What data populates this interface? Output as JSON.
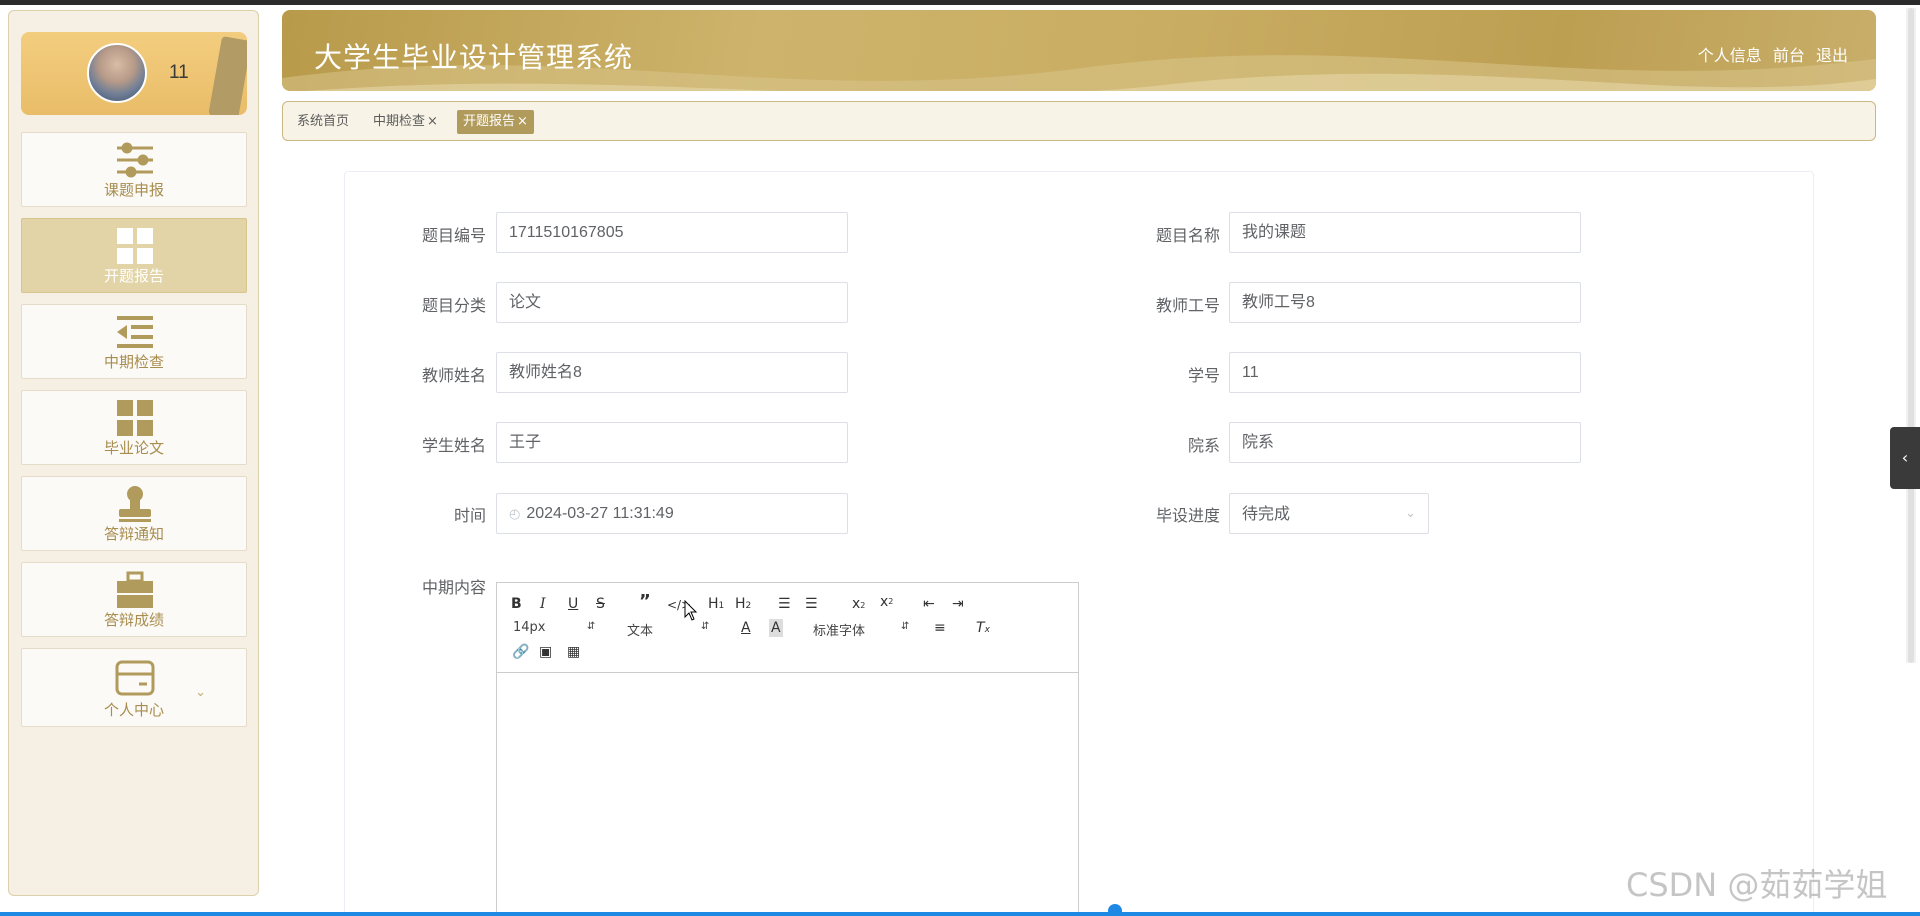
{
  "user": {
    "name": "11"
  },
  "sidebar": {
    "items": [
      {
        "label": "课题申报",
        "icon": "sliders-icon",
        "active": false
      },
      {
        "label": "开题报告",
        "icon": "grid-icon",
        "active": true
      },
      {
        "label": "中期检查",
        "icon": "indent-list-icon",
        "active": false
      },
      {
        "label": "毕业论文",
        "icon": "grid-icon",
        "active": false
      },
      {
        "label": "答辩通知",
        "icon": "stamp-icon",
        "active": false
      },
      {
        "label": "答辩成绩",
        "icon": "briefcase-icon",
        "active": false
      },
      {
        "label": "个人中心",
        "icon": "wallet-icon",
        "active": false,
        "expandable": true
      }
    ]
  },
  "header": {
    "title": "大学生毕业设计管理系统",
    "links": [
      "个人信息",
      "前台",
      "退出"
    ]
  },
  "tabs": [
    {
      "label": "系统首页",
      "closable": false,
      "active": false
    },
    {
      "label": "中期检查",
      "closable": true,
      "active": false
    },
    {
      "label": "开题报告",
      "closable": true,
      "active": true
    }
  ],
  "close_glyph": "×",
  "form": {
    "topic_no": {
      "label": "题目编号",
      "value": "1711510167805"
    },
    "topic_name": {
      "label": "题目名称",
      "value": "我的课题"
    },
    "topic_type": {
      "label": "题目分类",
      "value": "论文"
    },
    "teacher_no": {
      "label": "教师工号",
      "value": "教师工号8"
    },
    "teacher_name": {
      "label": "教师姓名",
      "value": "教师姓名8"
    },
    "student_no": {
      "label": "学号",
      "value": "11"
    },
    "student_name": {
      "label": "学生姓名",
      "value": "王子"
    },
    "department": {
      "label": "院系",
      "value": "院系"
    },
    "time": {
      "label": "时间",
      "value": "2024-03-27 11:31:49"
    },
    "progress": {
      "label": "毕设进度",
      "value": "待完成"
    },
    "content": {
      "label": "中期内容"
    }
  },
  "editor": {
    "font_size": "14px",
    "header_select": "文本",
    "font_family": "标准字体"
  },
  "watermark": "CSDN @茹茹学姐",
  "colors": {
    "accent": "#b09a5c",
    "sidebar_active": "#e2d4a6",
    "menu_text": "#a88d4f"
  }
}
